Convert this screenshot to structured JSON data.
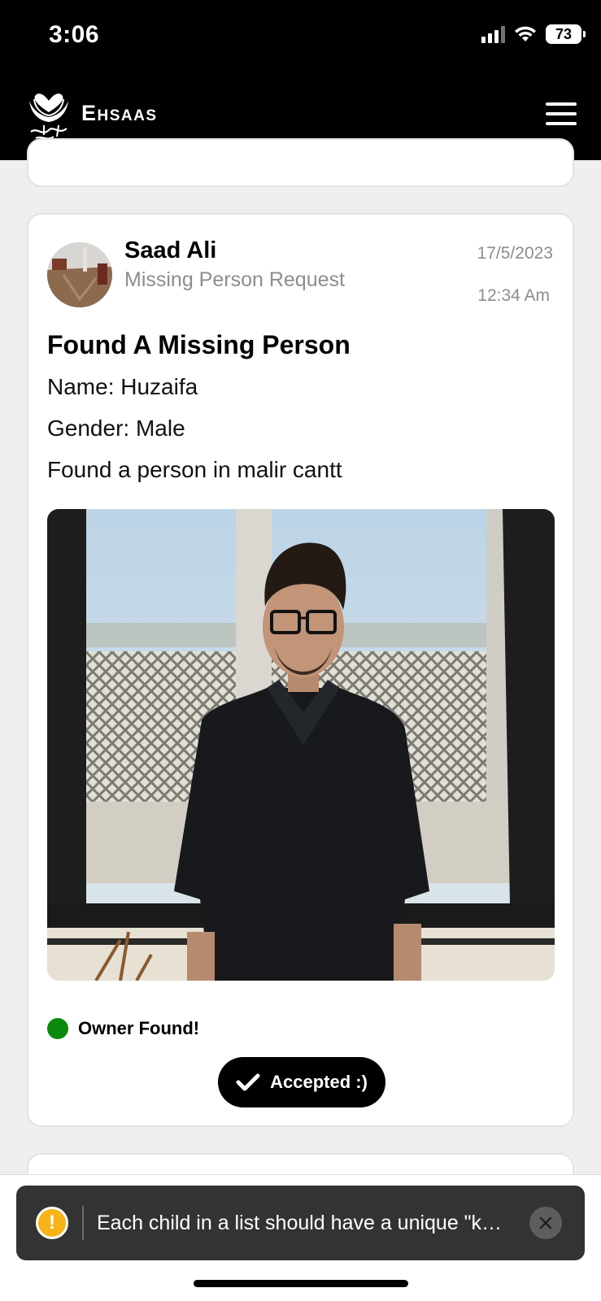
{
  "status_bar": {
    "time": "3:06",
    "battery": "73",
    "icons": [
      "signal-icon",
      "wifi-icon",
      "battery-icon"
    ]
  },
  "header": {
    "app_title": "Ehsaas",
    "logo": "ehsaas-logo",
    "menu_icon": "hamburger-menu-icon"
  },
  "post": {
    "author_name": "Saad Ali",
    "request_type": "Missing Person Request",
    "date": "17/5/2023",
    "time": "12:34 Am",
    "title": "Found A Missing Person",
    "name_line": "Name: Huzaifa",
    "gender_line": "Gender: Male",
    "description": "Found a person in malir cantt",
    "status_text": "Owner Found!",
    "status_color": "#0a8a0a",
    "action_label": "Accepted :)"
  },
  "toast": {
    "message": "Each child in a list should have a unique \"k…",
    "icon": "warning-icon",
    "close_icon": "close-icon"
  },
  "colors": {
    "header_bg": "#000000",
    "page_bg": "#efefef",
    "toast_bg": "#333333",
    "warning": "#f6b418"
  }
}
